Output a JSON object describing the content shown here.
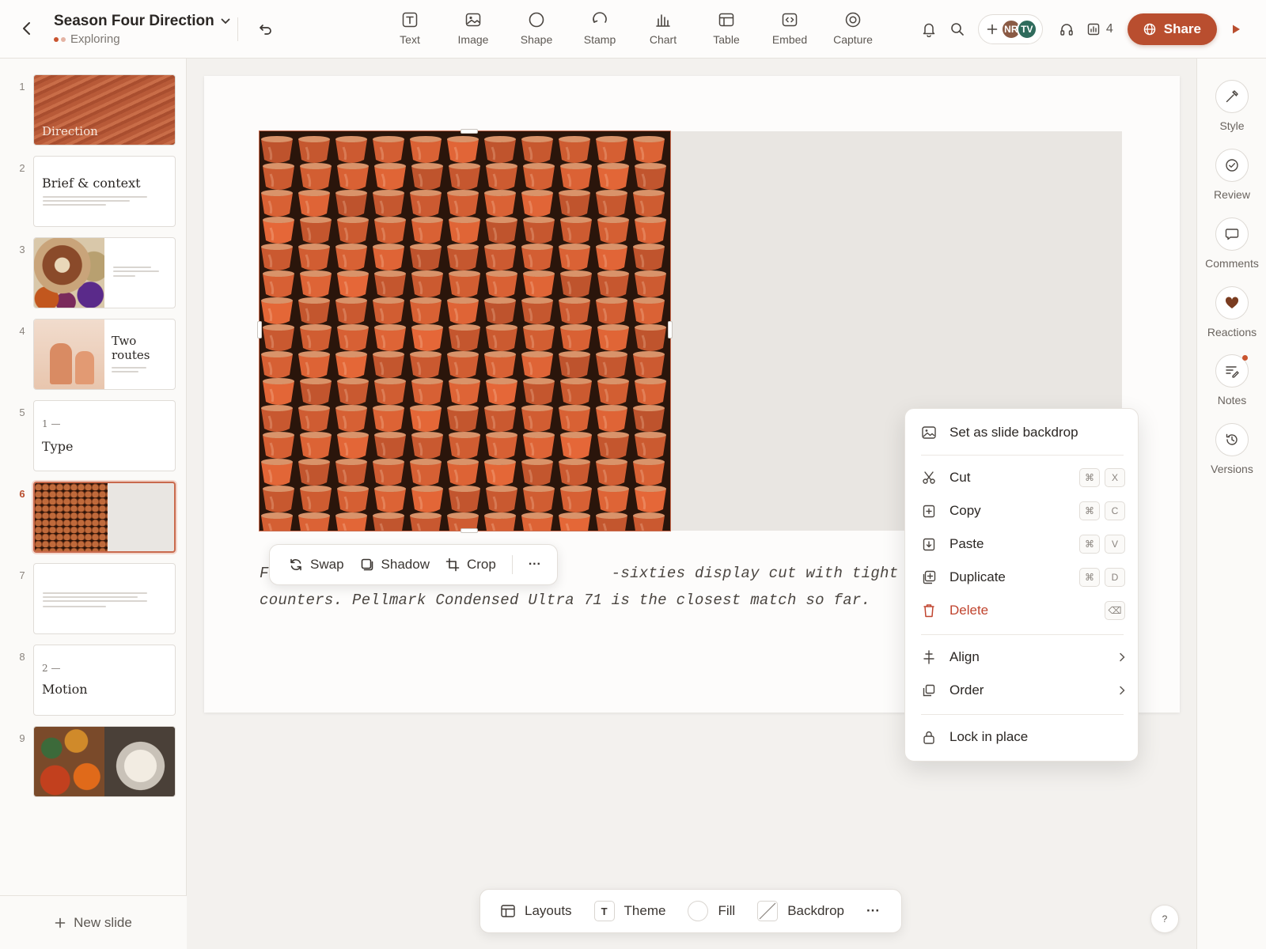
{
  "header": {
    "title": "Season Four Direction",
    "status": "Exploring",
    "insert_tools": [
      {
        "label": "Text",
        "icon": "text-icon"
      },
      {
        "label": "Image",
        "icon": "image-icon"
      },
      {
        "label": "Shape",
        "icon": "shape-icon"
      },
      {
        "label": "Stamp",
        "icon": "stamp-icon"
      },
      {
        "label": "Chart",
        "icon": "chart-icon"
      },
      {
        "label": "Table",
        "icon": "table-icon"
      },
      {
        "label": "Embed",
        "icon": "embed-icon"
      },
      {
        "label": "Capture",
        "icon": "capture-icon"
      }
    ],
    "collaborators": [
      "NR",
      "TV"
    ],
    "view_count": "4",
    "share_label": "Share"
  },
  "colors": {
    "accent": "#b94e2f",
    "status_dot_1": "#c9542f",
    "status_dot_2": "#e4b3a3",
    "avatar_nr": "#8a5a44",
    "avatar_tv": "#2f6b5c",
    "danger": "#c0442e"
  },
  "slides": [
    {
      "number": "1",
      "title": "Direction"
    },
    {
      "number": "2",
      "title": "Brief & context"
    },
    {
      "number": "3",
      "title": ""
    },
    {
      "number": "4",
      "title": "Two routes"
    },
    {
      "number": "5",
      "kicker": "1 —",
      "title": "Type"
    },
    {
      "number": "6",
      "title": "",
      "active": true
    },
    {
      "number": "7",
      "title": ""
    },
    {
      "number": "8",
      "kicker": "2 —",
      "title": "Motion"
    },
    {
      "number": "9",
      "title": ""
    }
  ],
  "new_slide_label": "New slide",
  "canvas": {
    "caption_line1": "Fo                                    -sixties display cut with tight",
    "caption_line2": "counters. Pellmark Condensed Ultra 71 is the closest match so far."
  },
  "image_toolbar": {
    "swap": "Swap",
    "shadow": "Shadow",
    "crop": "Crop",
    "more": "···"
  },
  "context_menu": {
    "backdrop": "Set as slide backdrop",
    "cut": "Cut",
    "copy": "Copy",
    "paste": "Paste",
    "duplicate": "Duplicate",
    "delete": "Delete",
    "align": "Align",
    "order": "Order",
    "lock": "Lock in place",
    "shortcut_mod": "⌘",
    "cut_key": "X",
    "copy_key": "C",
    "paste_key": "V",
    "duplicate_key": "D",
    "delete_key": "⌫"
  },
  "right_rail": [
    {
      "label": "Style",
      "icon": "style-icon"
    },
    {
      "label": "Review",
      "icon": "review-icon"
    },
    {
      "label": "Comments",
      "icon": "comments-icon"
    },
    {
      "label": "Reactions",
      "icon": "heart-icon"
    },
    {
      "label": "Notes",
      "icon": "notes-icon"
    },
    {
      "label": "Versions",
      "icon": "versions-icon"
    }
  ],
  "bottom_bar": {
    "layouts": "Layouts",
    "theme": "Theme",
    "theme_glyph": "T",
    "fill": "Fill",
    "backdrop": "Backdrop",
    "more": "···"
  },
  "help": "?"
}
